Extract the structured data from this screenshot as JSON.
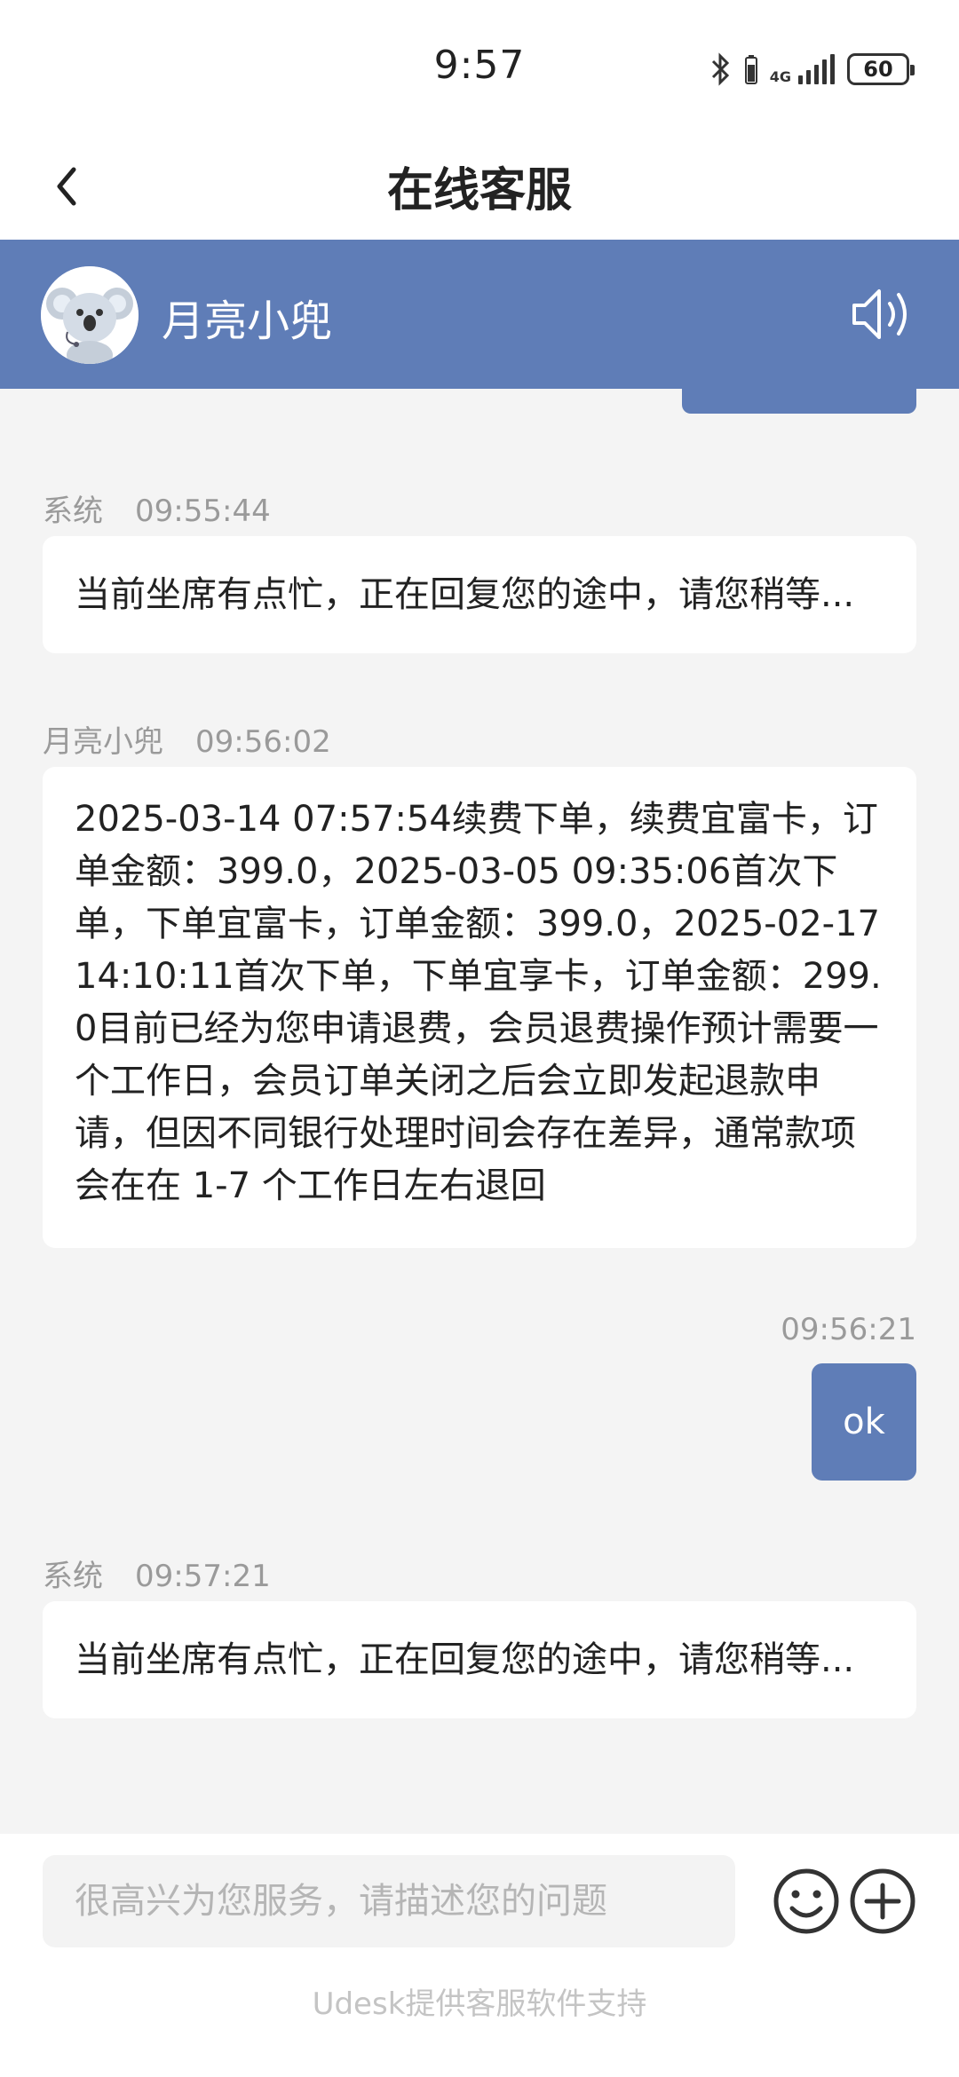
{
  "status_bar": {
    "time": "9:57",
    "network": "4G",
    "battery": "60"
  },
  "header": {
    "title": "在线客服"
  },
  "agent": {
    "name": "月亮小兜"
  },
  "messages": [
    {
      "sender": "系统",
      "time": "09:55:44",
      "text": "当前坐席有点忙，正在回复您的途中，请您稍等..."
    },
    {
      "sender": "月亮小兜",
      "time": "09:56:02",
      "text": "2025-03-14 07:57:54续费下单，续费宜富卡，订单金额：399.0，2025-03-05 09:35:06首次下单，下单宜富卡，订单金额：399.0，2025-02-17 14:10:11首次下单，下单宜享卡，订单金额：299.0目前已经为您申请退费，会员退费操作预计需要一个工作日，会员订单关闭之后会立即发起退款申请，但因不同银行处理时间会存在差异，通常款项会在在 1-7 个工作日左右退回"
    },
    {
      "sender": "",
      "time": "09:56:21",
      "text": "ok"
    },
    {
      "sender": "系统",
      "time": "09:57:21",
      "text": "当前坐席有点忙，正在回复您的途中，请您稍等..."
    }
  ],
  "input": {
    "placeholder": "很高兴为您服务，请描述您的问题"
  },
  "footer": {
    "powered_by": "Udesk提供客服软件支持"
  },
  "colors": {
    "accent": "#5f7db7",
    "background": "#f4f4f4"
  },
  "icons": {
    "back": "chevron-left-icon",
    "speaker": "speaker-icon",
    "emoji": "smiley-icon",
    "add": "plus-circle-icon"
  }
}
